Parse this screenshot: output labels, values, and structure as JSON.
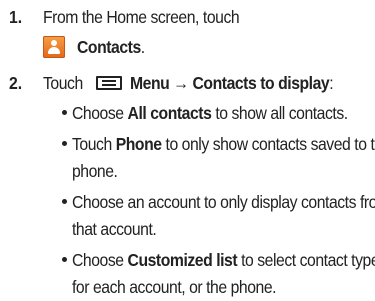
{
  "steps": [
    {
      "number": "1.",
      "text": "From the Home screen, touch",
      "icon": "contacts-icon",
      "target": "Contacts",
      "end": "."
    },
    {
      "number": "2.",
      "text_before": "Touch",
      "icon": "menu-icon",
      "menu_label": "Menu",
      "arrow": "→",
      "target": "Contacts to display",
      "end": ":"
    }
  ],
  "bullets": [
    {
      "pre": "Choose ",
      "bold": "All contacts",
      "post": " to show all contacts."
    },
    {
      "pre": "Touch ",
      "bold": "Phone",
      "post": " to only show contacts saved to the",
      "cont": "phone."
    },
    {
      "pre": "Choose an account to only display contacts from",
      "cont": "that account."
    },
    {
      "pre": "Choose ",
      "bold": "Customized list",
      "post": " to select contact types",
      "cont": "for each account, or the phone."
    }
  ]
}
